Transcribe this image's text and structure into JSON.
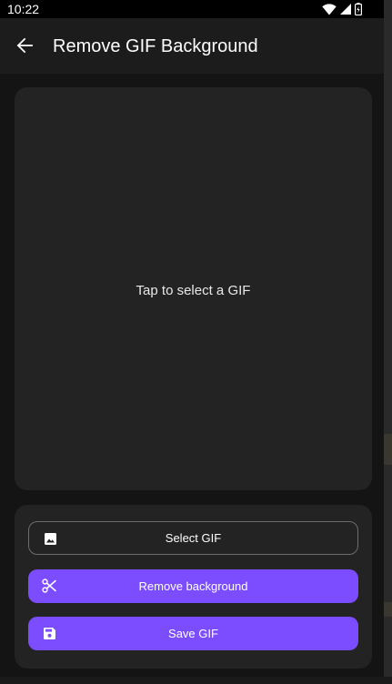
{
  "status_bar": {
    "time": "10:22",
    "icons": [
      "wifi-icon",
      "cellular-signal-icon",
      "battery-icon"
    ]
  },
  "app_bar": {
    "back_icon": "arrow-left-icon",
    "title": "Remove GIF Background"
  },
  "preview": {
    "hint": "Tap to select a GIF"
  },
  "actions": {
    "select": {
      "label": "Select GIF",
      "icon": "image-icon"
    },
    "remove": {
      "label": "Remove background",
      "icon": "scissors-icon"
    },
    "save": {
      "label": "Save GIF",
      "icon": "floppy-disk-icon"
    }
  },
  "colors": {
    "accent": "#7c4dff",
    "background": "#141414",
    "surface": "#232323",
    "app_bar": "#1c1c1c"
  }
}
